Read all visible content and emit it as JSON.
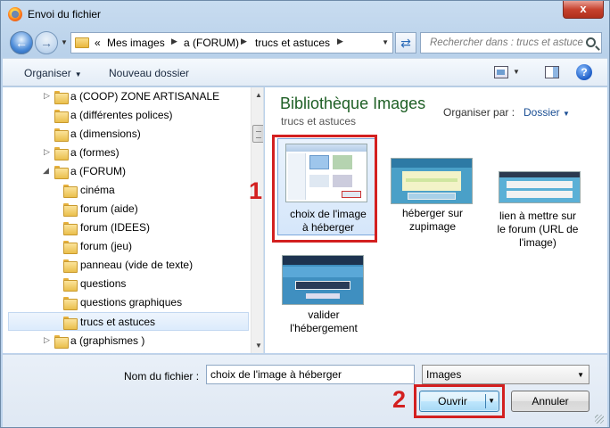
{
  "window": {
    "title": "Envoi du fichier",
    "close_glyph": "x",
    "colors": {
      "accent": "#d32020",
      "library_title": "#1e5f25"
    }
  },
  "address_bar": {
    "overflow": "«",
    "crumbs": [
      "Mes images",
      "a (FORUM)",
      "trucs et astuces"
    ]
  },
  "search": {
    "placeholder": "Rechercher dans : trucs et astuces"
  },
  "toolbar": {
    "organize_label": "Organiser",
    "new_folder_label": "Nouveau dossier",
    "help_glyph": "?"
  },
  "sidebar": {
    "items": [
      {
        "label": "a (COOP) ZONE  ARTISANALE",
        "level": 0,
        "expander": "collapsed"
      },
      {
        "label": "a (différentes polices)",
        "level": 0,
        "expander": "none"
      },
      {
        "label": "a (dimensions)",
        "level": 0,
        "expander": "none"
      },
      {
        "label": "a (formes)",
        "level": 0,
        "expander": "collapsed"
      },
      {
        "label": "a (FORUM)",
        "level": 0,
        "expander": "expanded"
      },
      {
        "label": "cinéma",
        "level": 1,
        "expander": "none"
      },
      {
        "label": "forum (aide)",
        "level": 1,
        "expander": "none"
      },
      {
        "label": "forum (IDEES)",
        "level": 1,
        "expander": "none"
      },
      {
        "label": "forum (jeu)",
        "level": 1,
        "expander": "none"
      },
      {
        "label": "panneau (vide de texte)",
        "level": 1,
        "expander": "none"
      },
      {
        "label": "questions",
        "level": 1,
        "expander": "none"
      },
      {
        "label": "questions graphiques",
        "level": 1,
        "expander": "none"
      },
      {
        "label": "trucs et astuces",
        "level": 1,
        "expander": "none",
        "selected": true
      },
      {
        "label": "a (graphismes )",
        "level": 0,
        "expander": "collapsed"
      }
    ]
  },
  "library": {
    "title": "Bibliothèque Images",
    "subtitle": "trucs et astuces",
    "arrange_label": "Organiser par :",
    "arrange_value": "Dossier",
    "files": [
      {
        "caption": [
          "choix de l'image",
          "à héberger"
        ],
        "selected": true
      },
      {
        "caption": [
          "héberger sur",
          "zupimage"
        ]
      },
      {
        "caption": [
          "lien à mettre sur",
          "le forum (URL de",
          "l'image)"
        ]
      },
      {
        "caption": [
          "valider",
          "l'hébergement"
        ]
      }
    ]
  },
  "annotations": {
    "step1": "1",
    "step2": "2"
  },
  "footer": {
    "filename_label": "Nom du fichier :",
    "filename_value": "choix de l'image à héberger",
    "filter_value": "Images",
    "open_label": "Ouvrir",
    "cancel_label": "Annuler"
  }
}
